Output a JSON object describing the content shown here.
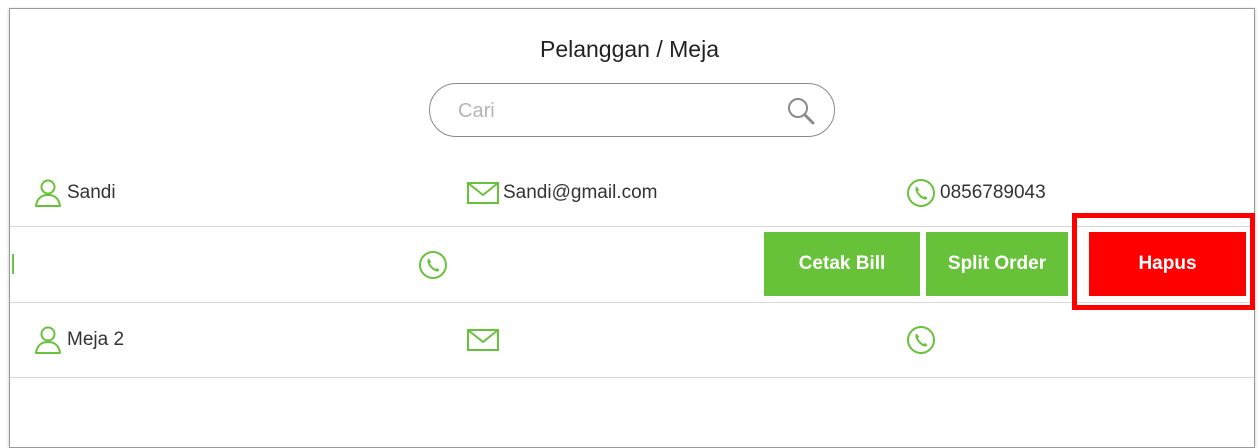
{
  "header": {
    "title": "Pelanggan / Meja"
  },
  "search": {
    "placeholder": "Cari",
    "value": ""
  },
  "rows": [
    {
      "name": "Sandi",
      "email": "Sandi@gmail.com",
      "phone": "0856789043"
    },
    {
      "name": "",
      "email": "",
      "phone": "",
      "actions": {
        "print_bill_label": "Cetak Bill",
        "split_order_label": "Split Order",
        "delete_label": "Hapus"
      }
    },
    {
      "name": "Meja 2",
      "email": "",
      "phone": ""
    }
  ],
  "colors": {
    "accent_green": "#67c23a",
    "delete_red": "#ff0000",
    "highlight_red": "#ff0000",
    "divider": "#d6d6d6"
  },
  "icons": [
    "search-icon",
    "user-icon",
    "mail-icon",
    "phone-icon"
  ]
}
